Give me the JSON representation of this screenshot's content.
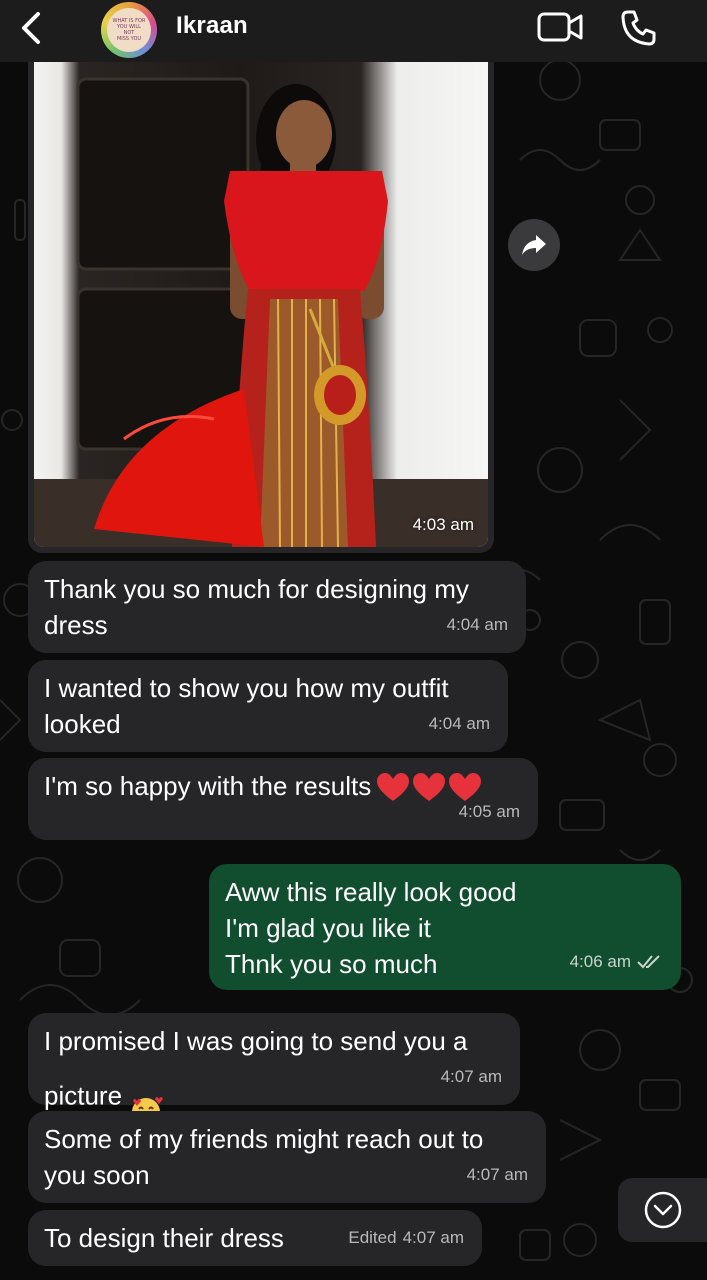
{
  "header": {
    "contact_name": "Ikraan",
    "avatar_text": [
      "WHAT IS FOR",
      "YOU WILL",
      "NOT",
      "MISS YOU"
    ],
    "icons": {
      "back": "chevron-left-icon",
      "video": "video-camera-icon",
      "call": "phone-icon"
    }
  },
  "colors": {
    "header_bg": "#1c1c1d",
    "incoming_bubble": "#262628",
    "outgoing_bubble": "#114d2f",
    "heart": "#e5323b",
    "background": "#0b0b0b"
  },
  "messages": [
    {
      "type": "image",
      "direction": "incoming",
      "time": "4:03 am"
    },
    {
      "type": "text",
      "direction": "incoming",
      "text": "Thank you so much for designing my\ndress",
      "time": "4:04 am"
    },
    {
      "type": "text",
      "direction": "incoming",
      "text": "I wanted to show you how my outfit\nlooked",
      "time": "4:04 am"
    },
    {
      "type": "text",
      "direction": "incoming",
      "text": "I'm so happy with the results",
      "emoji": "❤️❤️❤️",
      "time": "4:05 am"
    },
    {
      "type": "text",
      "direction": "outgoing",
      "text": "Aww this really look good\nI'm glad you like it\nThnk you so much",
      "time": "4:06 am",
      "status": "read"
    },
    {
      "type": "text",
      "direction": "incoming",
      "text": "I promised I was going to send you a\npicture",
      "emoji": "🥰",
      "time": "4:07 am"
    },
    {
      "type": "text",
      "direction": "incoming",
      "text": "Some of my friends might reach out to\nyou soon",
      "time": "4:07 am"
    },
    {
      "type": "text",
      "direction": "incoming",
      "text": "To design their dress",
      "edited_label": "Edited",
      "time": "4:07 am"
    }
  ],
  "controls": {
    "forward_icon": "forward-arrow-icon",
    "scroll_down_icon": "chevron-down-circle-icon"
  }
}
